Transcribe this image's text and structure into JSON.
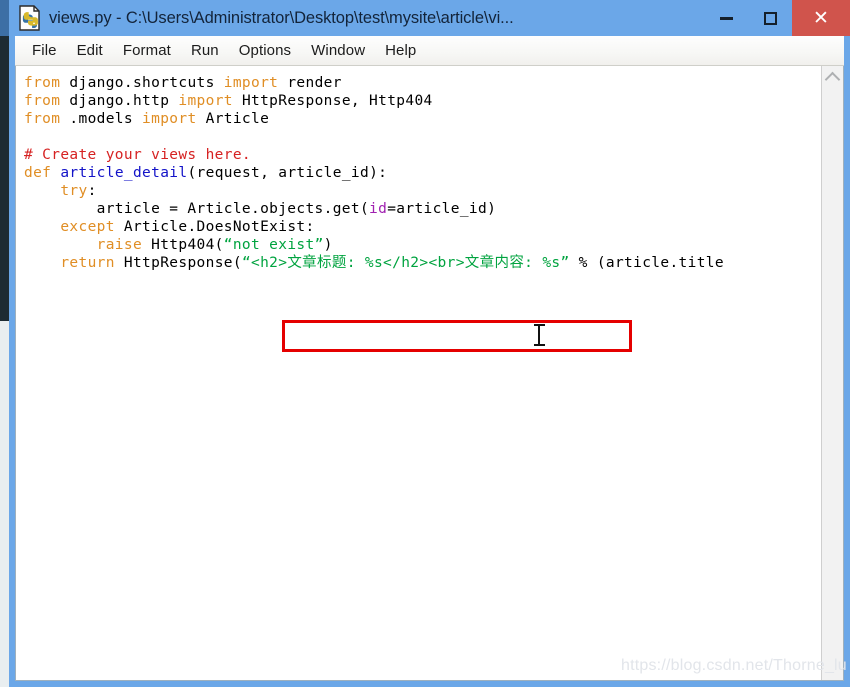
{
  "window": {
    "title": "views.py - C:\\Users\\Administrator\\Desktop\\test\\mysite\\article\\vi...",
    "icon": "python-file-icon",
    "controls": {
      "minimize_label": "",
      "maximize_label": "",
      "close_label": "✕"
    },
    "titlebar_color": "#6ba7e8",
    "close_button_color": "#d0544c"
  },
  "menu": {
    "items": [
      {
        "label": "File"
      },
      {
        "label": "Edit"
      },
      {
        "label": "Format"
      },
      {
        "label": "Run"
      },
      {
        "label": "Options"
      },
      {
        "label": "Window"
      },
      {
        "label": "Help"
      }
    ]
  },
  "editor": {
    "language": "python",
    "syntax_colors": {
      "keyword": "#e08e25",
      "function_name": "#1313c8",
      "comment": "#d62222",
      "string": "#00a33f",
      "keyword_argument": "#a020b0",
      "plain": "#000000"
    },
    "lines": [
      {
        "n": 1,
        "tokens": [
          {
            "t": "from",
            "c": "kw"
          },
          {
            "t": " django.shortcuts ",
            "c": "plain"
          },
          {
            "t": "import",
            "c": "kw"
          },
          {
            "t": " render",
            "c": "plain"
          }
        ]
      },
      {
        "n": 2,
        "tokens": [
          {
            "t": "from",
            "c": "kw"
          },
          {
            "t": " django.http ",
            "c": "plain"
          },
          {
            "t": "import",
            "c": "kw"
          },
          {
            "t": " HttpResponse, Http404",
            "c": "plain"
          }
        ]
      },
      {
        "n": 3,
        "tokens": [
          {
            "t": "from",
            "c": "kw"
          },
          {
            "t": " .models ",
            "c": "plain"
          },
          {
            "t": "import",
            "c": "kw"
          },
          {
            "t": " Article",
            "c": "plain"
          }
        ]
      },
      {
        "n": 4,
        "tokens": [
          {
            "t": "",
            "c": "plain"
          }
        ]
      },
      {
        "n": 5,
        "tokens": [
          {
            "t": "# Create your views here.",
            "c": "com"
          }
        ]
      },
      {
        "n": 6,
        "tokens": [
          {
            "t": "def",
            "c": "kw"
          },
          {
            "t": " ",
            "c": "plain"
          },
          {
            "t": "article_detail",
            "c": "fn"
          },
          {
            "t": "(request, article_id):",
            "c": "plain"
          }
        ]
      },
      {
        "n": 7,
        "tokens": [
          {
            "t": "    ",
            "c": "plain"
          },
          {
            "t": "try",
            "c": "kw"
          },
          {
            "t": ":",
            "c": "plain"
          }
        ]
      },
      {
        "n": 8,
        "tokens": [
          {
            "t": "        article = Article.objects.get(",
            "c": "plain"
          },
          {
            "t": "id",
            "c": "kwarg"
          },
          {
            "t": "=article_id)",
            "c": "plain"
          }
        ]
      },
      {
        "n": 9,
        "tokens": [
          {
            "t": "    ",
            "c": "plain"
          },
          {
            "t": "except",
            "c": "kw"
          },
          {
            "t": " Article.DoesNotExist:",
            "c": "plain"
          }
        ]
      },
      {
        "n": 10,
        "tokens": [
          {
            "t": "        ",
            "c": "plain"
          },
          {
            "t": "raise",
            "c": "kw"
          },
          {
            "t": " Http404(",
            "c": "plain"
          },
          {
            "t": "“not exist”",
            "c": "str"
          },
          {
            "t": ")",
            "c": "plain"
          }
        ]
      },
      {
        "n": 11,
        "tokens": [
          {
            "t": "    ",
            "c": "plain"
          },
          {
            "t": "return",
            "c": "kw"
          },
          {
            "t": " HttpResponse(",
            "c": "plain"
          },
          {
            "t": "“<h2>文章标题: %s</h2><br>文章内容: %s”",
            "c": "str"
          },
          {
            "t": " % (article.title",
            "c": "plain"
          }
        ]
      }
    ]
  },
  "scrollbar": {
    "up_arrow": "chevron-up-icon",
    "orientation": "vertical"
  },
  "annotation": {
    "shape": "rectangle",
    "color": "#e50000",
    "targets_text": "“<h2>文章标题: %s</h2><br>文章内容: %s”"
  },
  "cursor": {
    "type": "i-beam"
  },
  "watermark": {
    "text": "https://blog.csdn.net/Thorne_lu"
  }
}
